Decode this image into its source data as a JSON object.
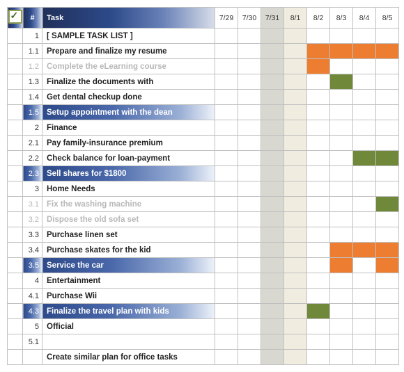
{
  "header": {
    "check": "",
    "num": "#",
    "task": "Task",
    "dates": [
      "7/29",
      "7/30",
      "7/31",
      "8/1",
      "8/2",
      "8/3",
      "8/4",
      "8/5"
    ],
    "dateShade": [
      "",
      "",
      "a",
      "b",
      "",
      "",
      "",
      ""
    ]
  },
  "rows": [
    {
      "num": "1",
      "task": "[ SAMPLE TASK LIST ]",
      "style": "",
      "bars": {}
    },
    {
      "num": "1.1",
      "task": "Prepare and finalize my resume",
      "style": "",
      "bars": {
        "4": "orange",
        "5": "orange",
        "6": "orange",
        "7": "orange"
      }
    },
    {
      "num": "1.2",
      "task": "Complete the eLearning course",
      "style": "muted",
      "bars": {
        "3": "orange",
        "4": "orange"
      }
    },
    {
      "num": "1.3",
      "task": "Finalize the documents with",
      "style": "",
      "bars": {
        "2": "green",
        "3": "green",
        "5": "green"
      }
    },
    {
      "num": "1.4",
      "task": "Get dental checkup done",
      "style": "",
      "bars": {}
    },
    {
      "num": "1.5",
      "task": "Setup appointment with the dean",
      "style": "hl",
      "bars": {}
    },
    {
      "num": "2",
      "task": "Finance",
      "style": "",
      "bars": {}
    },
    {
      "num": "2.1",
      "task": "Pay family-insurance premium",
      "style": "",
      "bars": {}
    },
    {
      "num": "2.2",
      "task": "Check balance for loan-payment",
      "style": "",
      "bars": {
        "6": "green",
        "7": "green"
      }
    },
    {
      "num": "2.3",
      "task": "Sell shares for $1800",
      "style": "hl",
      "bars": {}
    },
    {
      "num": "3",
      "task": "Home Needs",
      "style": "",
      "bars": {}
    },
    {
      "num": "3.1",
      "task": "Fix the washing machine",
      "style": "muted",
      "bars": {
        "7": "green"
      }
    },
    {
      "num": "3.2",
      "task": "Dispose the old sofa set",
      "style": "muted",
      "bars": {}
    },
    {
      "num": "3.3",
      "task": "Purchase linen set",
      "style": "",
      "bars": {}
    },
    {
      "num": "3.4",
      "task": "Purchase skates for the kid",
      "style": "",
      "bars": {
        "5": "orange",
        "6": "orange",
        "7": "orange"
      }
    },
    {
      "num": "3.5",
      "task": "Service the car",
      "style": "hl",
      "bars": {
        "5": "orange",
        "7": "orange"
      }
    },
    {
      "num": "4",
      "task": "Entertainment",
      "style": "",
      "bars": {}
    },
    {
      "num": "4.1",
      "task": "Purchase Wii",
      "style": "",
      "bars": {}
    },
    {
      "num": "4.3",
      "task": "Finalize the travel plan with kids",
      "style": "hl",
      "bars": {
        "4": "green"
      }
    },
    {
      "num": "5",
      "task": "Official",
      "style": "",
      "bars": {}
    },
    {
      "num": "5.1",
      "task": "",
      "style": "",
      "bars": {}
    },
    {
      "num": "",
      "task": "Create similar plan for office tasks",
      "style": "",
      "bars": {}
    }
  ]
}
